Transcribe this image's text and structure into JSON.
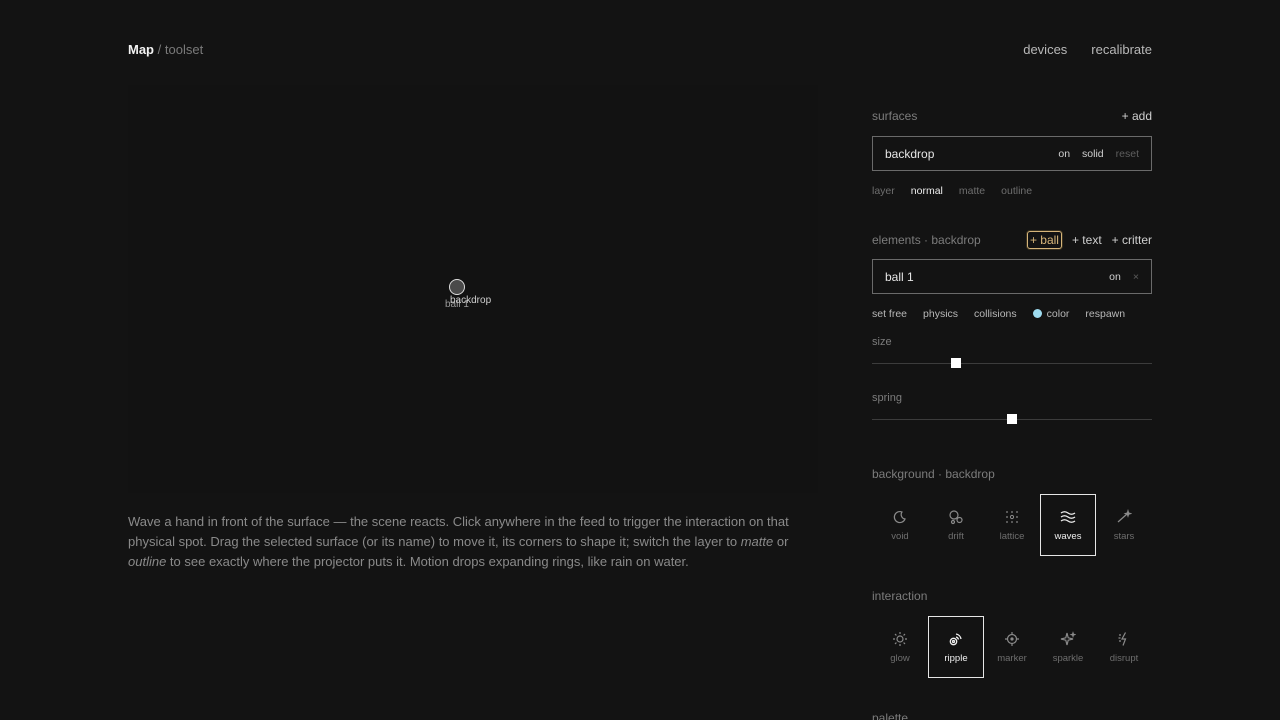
{
  "header": {
    "title": "Map",
    "sep": "/",
    "subtitle": "toolset",
    "nav": [
      "devices",
      "recalibrate"
    ]
  },
  "feed": {
    "ball_label": "ball 1",
    "surface_label": "backdrop"
  },
  "help": {
    "p1": "Wave a hand in front of the surface — the scene reacts. Click anywhere in the feed to trigger the interaction on that physical spot. Drag the selected surface (or its name) to move it, its corners to shape it; switch the layer to ",
    "matte": "matte",
    "or": " or ",
    "outline": "outline",
    "p2": " to see exactly where the projector puts it. Motion drops expanding rings, like rain on water."
  },
  "surfaces": {
    "title": "surfaces",
    "add": "+ add",
    "item": {
      "name": "backdrop",
      "on": "on",
      "solid": "solid",
      "reset": "reset"
    },
    "layer_label": "layer",
    "layers": [
      "normal",
      "matte",
      "outline"
    ],
    "active_layer": "normal"
  },
  "elements": {
    "title": "elements · backdrop",
    "adds": [
      "+ ball",
      "+ text",
      "+ critter"
    ],
    "item": {
      "name": "ball 1",
      "on": "on",
      "remove": "×"
    },
    "controls": [
      "set free",
      "physics",
      "collisions",
      "color",
      "respawn"
    ],
    "color_value": "#9fdcf0",
    "size_label": "size",
    "size_value": 0.3,
    "spring_label": "spring",
    "spring_value": 0.5
  },
  "background": {
    "title": "background · backdrop",
    "options": [
      {
        "label": "void",
        "icon": "moon-icon"
      },
      {
        "label": "drift",
        "icon": "bubbles-icon"
      },
      {
        "label": "lattice",
        "icon": "lattice-icon"
      },
      {
        "label": "waves",
        "icon": "waves-icon"
      },
      {
        "label": "stars",
        "icon": "stars-icon"
      }
    ],
    "selected": "waves"
  },
  "interaction": {
    "title": "interaction",
    "options": [
      {
        "label": "glow",
        "icon": "sun-icon"
      },
      {
        "label": "ripple",
        "icon": "ripple-icon"
      },
      {
        "label": "marker",
        "icon": "crosshair-icon"
      },
      {
        "label": "sparkle",
        "icon": "sparkle-icon"
      },
      {
        "label": "disrupt",
        "icon": "bolt-icon"
      }
    ],
    "selected": "ripple"
  },
  "palette": {
    "title": "palette"
  }
}
